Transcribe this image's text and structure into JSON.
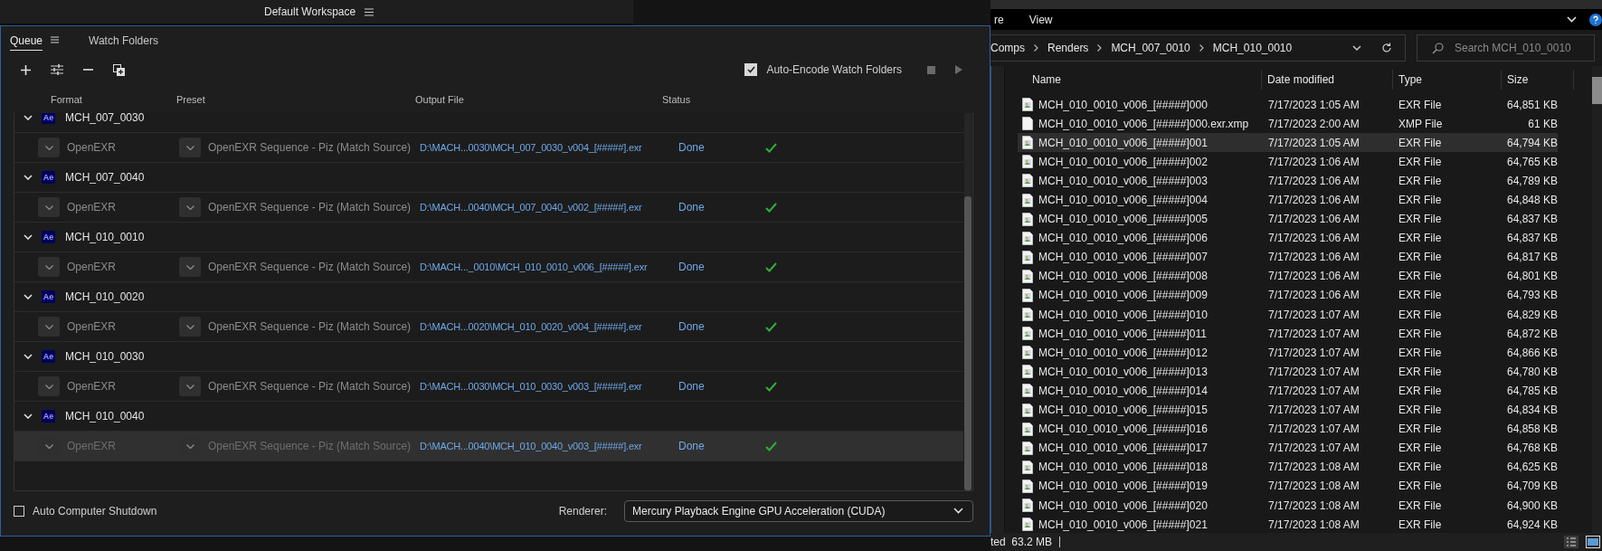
{
  "workspace_bar": {
    "title": "Default Workspace"
  },
  "queue_panel": {
    "tabs": [
      {
        "label": "Queue",
        "selected": true
      },
      {
        "label": "Watch Folders",
        "selected": false
      }
    ],
    "auto_encode": {
      "label": "Auto-Encode Watch Folders",
      "checked": true
    },
    "columns": [
      "Format",
      "Preset",
      "Output File",
      "Status"
    ],
    "groups": [
      {
        "badge": "Ae",
        "name": "MCH_007_0030",
        "expanded": true,
        "item": {
          "format": "OpenEXR",
          "preset": "OpenEXR Sequence - Piz (Match Source)",
          "output": "D:\\MACH...0030\\MCH_007_0030_v004_[#####].exr",
          "status": "Done",
          "complete": true,
          "selected": false
        }
      },
      {
        "badge": "Ae",
        "name": "MCH_007_0040",
        "expanded": true,
        "item": {
          "format": "OpenEXR",
          "preset": "OpenEXR Sequence - Piz (Match Source)",
          "output": "D:\\MACH...0040\\MCH_007_0040_v002_[#####].exr",
          "status": "Done",
          "complete": true,
          "selected": false
        }
      },
      {
        "badge": "Ae",
        "name": "MCH_010_0010",
        "expanded": true,
        "item": {
          "format": "OpenEXR",
          "preset": "OpenEXR Sequence - Piz (Match Source)",
          "output": "D:\\MACH..._0010\\MCH_010_0010_v006_[#####].exr",
          "status": "Done",
          "complete": true,
          "selected": false
        }
      },
      {
        "badge": "Ae",
        "name": "MCH_010_0020",
        "expanded": true,
        "item": {
          "format": "OpenEXR",
          "preset": "OpenEXR Sequence - Piz (Match Source)",
          "output": "D:\\MACH...0020\\MCH_010_0020_v004_[#####].exr",
          "status": "Done",
          "complete": true,
          "selected": false
        }
      },
      {
        "badge": "Ae",
        "name": "MCH_010_0030",
        "expanded": true,
        "item": {
          "format": "OpenEXR",
          "preset": "OpenEXR Sequence - Piz (Match Source)",
          "output": "D:\\MACH...0030\\MCH_010_0030_v003_[#####].exr",
          "status": "Done",
          "complete": true,
          "selected": false
        }
      },
      {
        "badge": "Ae",
        "name": "MCH_010_0040",
        "expanded": true,
        "item": {
          "format": "OpenEXR",
          "preset": "OpenEXR Sequence - Piz (Match Source)",
          "output": "D:\\MACH...0040\\MCH_010_0040_v003_[#####].exr",
          "status": "Done",
          "complete": true,
          "selected": true
        }
      }
    ],
    "auto_shutdown": {
      "label": "Auto Computer Shutdown",
      "checked": false
    },
    "renderer": {
      "label": "Renderer:",
      "value": "Mercury Playback Engine GPU Acceleration (CUDA)"
    }
  },
  "explorer": {
    "menu": [
      "re",
      "View"
    ],
    "breadcrumb": [
      "Comps",
      "Renders",
      "MCH_007_0010",
      "MCH_010_0010"
    ],
    "search": {
      "placeholder": "Search MCH_010_0010"
    },
    "columns": [
      "Name",
      "Date modified",
      "Type",
      "Size"
    ],
    "files": [
      {
        "kind": "image",
        "name": "MCH_010_0010_v006_[#####]000",
        "date": "7/17/2023 1:05 AM",
        "type": "EXR File",
        "size": "64,851 KB",
        "selected": false
      },
      {
        "kind": "plain",
        "name": "MCH_010_0010_v006_[#####]000.exr.xmp",
        "date": "7/17/2023 2:00 AM",
        "type": "XMP File",
        "size": "61 KB",
        "selected": false
      },
      {
        "kind": "image",
        "name": "MCH_010_0010_v006_[#####]001",
        "date": "7/17/2023 1:05 AM",
        "type": "EXR File",
        "size": "64,794 KB",
        "selected": true
      },
      {
        "kind": "image",
        "name": "MCH_010_0010_v006_[#####]002",
        "date": "7/17/2023 1:06 AM",
        "type": "EXR File",
        "size": "64,765 KB",
        "selected": false
      },
      {
        "kind": "image",
        "name": "MCH_010_0010_v006_[#####]003",
        "date": "7/17/2023 1:06 AM",
        "type": "EXR File",
        "size": "64,789 KB",
        "selected": false
      },
      {
        "kind": "image",
        "name": "MCH_010_0010_v006_[#####]004",
        "date": "7/17/2023 1:06 AM",
        "type": "EXR File",
        "size": "64,848 KB",
        "selected": false
      },
      {
        "kind": "image",
        "name": "MCH_010_0010_v006_[#####]005",
        "date": "7/17/2023 1:06 AM",
        "type": "EXR File",
        "size": "64,837 KB",
        "selected": false
      },
      {
        "kind": "image",
        "name": "MCH_010_0010_v006_[#####]006",
        "date": "7/17/2023 1:06 AM",
        "type": "EXR File",
        "size": "64,837 KB",
        "selected": false
      },
      {
        "kind": "image",
        "name": "MCH_010_0010_v006_[#####]007",
        "date": "7/17/2023 1:06 AM",
        "type": "EXR File",
        "size": "64,817 KB",
        "selected": false
      },
      {
        "kind": "image",
        "name": "MCH_010_0010_v006_[#####]008",
        "date": "7/17/2023 1:06 AM",
        "type": "EXR File",
        "size": "64,801 KB",
        "selected": false
      },
      {
        "kind": "image",
        "name": "MCH_010_0010_v006_[#####]009",
        "date": "7/17/2023 1:06 AM",
        "type": "EXR File",
        "size": "64,793 KB",
        "selected": false
      },
      {
        "kind": "image",
        "name": "MCH_010_0010_v006_[#####]010",
        "date": "7/17/2023 1:07 AM",
        "type": "EXR File",
        "size": "64,829 KB",
        "selected": false
      },
      {
        "kind": "image",
        "name": "MCH_010_0010_v006_[#####]011",
        "date": "7/17/2023 1:07 AM",
        "type": "EXR File",
        "size": "64,872 KB",
        "selected": false
      },
      {
        "kind": "image",
        "name": "MCH_010_0010_v006_[#####]012",
        "date": "7/17/2023 1:07 AM",
        "type": "EXR File",
        "size": "64,866 KB",
        "selected": false
      },
      {
        "kind": "image",
        "name": "MCH_010_0010_v006_[#####]013",
        "date": "7/17/2023 1:07 AM",
        "type": "EXR File",
        "size": "64,780 KB",
        "selected": false
      },
      {
        "kind": "image",
        "name": "MCH_010_0010_v006_[#####]014",
        "date": "7/17/2023 1:07 AM",
        "type": "EXR File",
        "size": "64,785 KB",
        "selected": false
      },
      {
        "kind": "image",
        "name": "MCH_010_0010_v006_[#####]015",
        "date": "7/17/2023 1:07 AM",
        "type": "EXR File",
        "size": "64,834 KB",
        "selected": false
      },
      {
        "kind": "image",
        "name": "MCH_010_0010_v006_[#####]016",
        "date": "7/17/2023 1:07 AM",
        "type": "EXR File",
        "size": "64,858 KB",
        "selected": false
      },
      {
        "kind": "image",
        "name": "MCH_010_0010_v006_[#####]017",
        "date": "7/17/2023 1:07 AM",
        "type": "EXR File",
        "size": "64,768 KB",
        "selected": false
      },
      {
        "kind": "image",
        "name": "MCH_010_0010_v006_[#####]018",
        "date": "7/17/2023 1:08 AM",
        "type": "EXR File",
        "size": "64,625 KB",
        "selected": false
      },
      {
        "kind": "image",
        "name": "MCH_010_0010_v006_[#####]019",
        "date": "7/17/2023 1:08 AM",
        "type": "EXR File",
        "size": "64,709 KB",
        "selected": false
      },
      {
        "kind": "image",
        "name": "MCH_010_0010_v006_[#####]020",
        "date": "7/17/2023 1:08 AM",
        "type": "EXR File",
        "size": "64,900 KB",
        "selected": false
      },
      {
        "kind": "image",
        "name": "MCH_010_0010_v006_[#####]021",
        "date": "7/17/2023 1:08 AM",
        "type": "EXR File",
        "size": "64,924 KB",
        "selected": false
      }
    ],
    "status": "ted  63.2 MB"
  }
}
